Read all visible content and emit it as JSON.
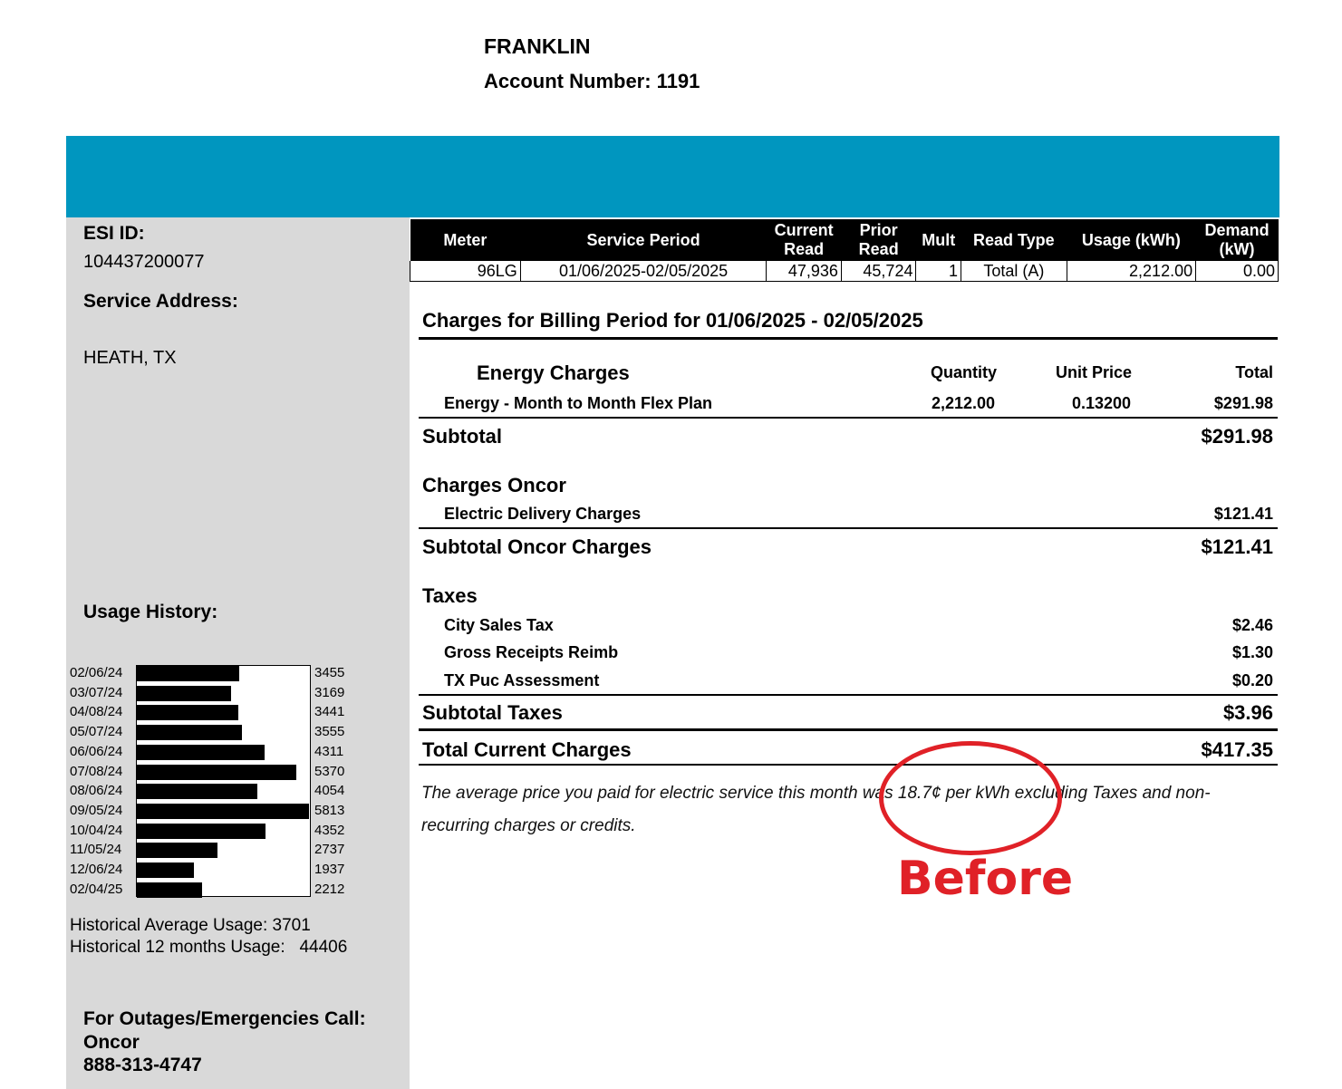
{
  "header": {
    "name": "FRANKLIN",
    "account_label": "Account Number: 1191"
  },
  "colors": {
    "banner": "#0096bf",
    "sidebar": "#d9d9d9",
    "annotation": "#e02127"
  },
  "sidebar": {
    "esi_label": "ESI ID:",
    "esi_value": "104437200077",
    "address_label": "Service Address:",
    "address_value": "HEATH, TX",
    "usage_history_label": "Usage History:",
    "historical_avg": "Historical Average Usage: 3701",
    "historical_12": "Historical 12 months Usage:   44406",
    "outage_label": "For Outages/Emergencies Call:",
    "outage_company": "Oncor",
    "outage_phone": "888-313-4747"
  },
  "usage_history": [
    {
      "date": "02/06/24",
      "kwh": 3455
    },
    {
      "date": "03/07/24",
      "kwh": 3169
    },
    {
      "date": "04/08/24",
      "kwh": 3441
    },
    {
      "date": "05/07/24",
      "kwh": 3555
    },
    {
      "date": "06/06/24",
      "kwh": 4311
    },
    {
      "date": "07/08/24",
      "kwh": 5370
    },
    {
      "date": "08/06/24",
      "kwh": 4054
    },
    {
      "date": "09/05/24",
      "kwh": 5813
    },
    {
      "date": "10/04/24",
      "kwh": 4352
    },
    {
      "date": "11/05/24",
      "kwh": 2737
    },
    {
      "date": "12/06/24",
      "kwh": 1937
    },
    {
      "date": "02/04/25",
      "kwh": 2212
    }
  ],
  "meter_table": {
    "headers": [
      "Meter",
      "Service Period",
      "Current Read",
      "Prior Read",
      "Mult",
      "Read Type",
      "Usage (kWh)",
      "Demand (kW)"
    ],
    "header_line1": [
      "Meter",
      "Service Period",
      "Current",
      "Prior",
      "Mult",
      "Read Type",
      "Usage (kWh)",
      "Demand"
    ],
    "header_line2": [
      "",
      "",
      "Read",
      "Read",
      "",
      "",
      "",
      "(kW)"
    ],
    "row": [
      "96LG",
      "01/06/2025-02/05/2025",
      "47,936",
      "45,724",
      "1",
      "Total (A)",
      "2,212.00",
      "0.00"
    ]
  },
  "charges": {
    "period_title": "Charges for Billing Period for  01/06/2025 - 02/05/2025",
    "energy_title": "Energy Charges",
    "col_quantity": "Quantity",
    "col_unit_price": "Unit Price",
    "col_total": "Total",
    "energy_item": "Energy - Month to Month Flex Plan",
    "energy_qty": "2,212.00",
    "energy_price": "0.13200",
    "energy_total": "$291.98",
    "subtotal_label": "Subtotal",
    "subtotal_value": "$291.98",
    "oncor_title": "Charges Oncor",
    "oncor_item": "Electric Delivery Charges",
    "oncor_item_value": "$121.41",
    "oncor_subtotal_label": "Subtotal Oncor Charges",
    "oncor_subtotal_value": "$121.41",
    "taxes_title": "Taxes",
    "taxes": [
      {
        "label": "City Sales Tax",
        "value": "$2.46"
      },
      {
        "label": "Gross Receipts Reimb",
        "value": "$1.30"
      },
      {
        "label": "TX Puc Assessment",
        "value": "$0.20"
      }
    ],
    "taxes_subtotal_label": "Subtotal Taxes",
    "taxes_subtotal_value": "$3.96",
    "total_label": "Total Current Charges",
    "total_value": "$417.35"
  },
  "note": {
    "line1": "The average price you paid for electric service this month was 18.7¢ per kWh excluding Taxes and non-",
    "line2": "recurring charges or credits."
  },
  "annotation": {
    "label": "Before"
  }
}
